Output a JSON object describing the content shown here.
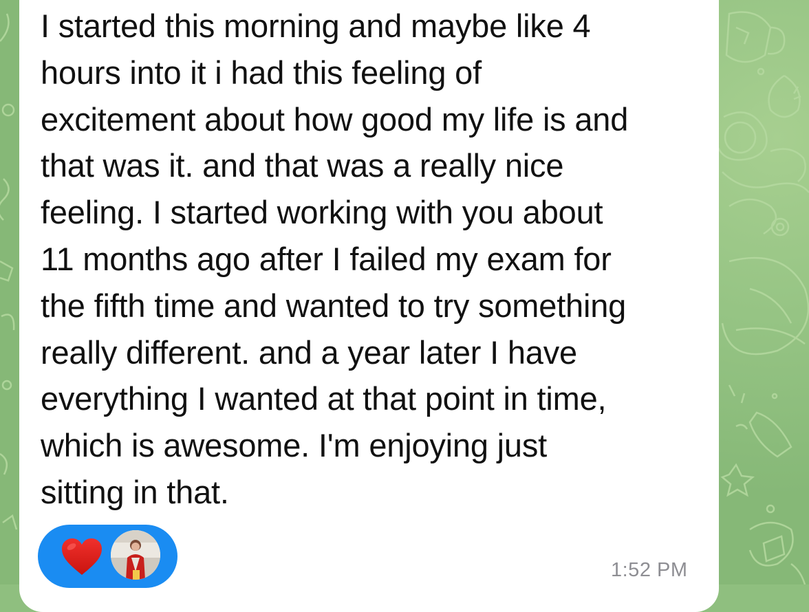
{
  "message": {
    "text": "I started this morning and maybe like 4\nhours into it i had this feeling of\nexcitement about how good my life is and\nthat was it. and that was a really nice\nfeeling. I started working with you about\n11 months ago after I failed my exam for\nthe fifth time and wanted to try something\nreally different. and a year later I have\neverything I wanted at that point in time,\nwhich is awesome. I'm enjoying just\nsitting in that.",
    "timestamp": "1:52 PM"
  },
  "reaction": {
    "emoji_icon": "red-heart-icon",
    "reactor": "user-avatar-photo",
    "pill_color": "#1a8cf2",
    "heart_color": "#e0211f"
  },
  "colors": {
    "bubble": "#ffffff",
    "background": "#8fbf7f",
    "text": "#111111",
    "timestamp": "#8e8e93"
  }
}
